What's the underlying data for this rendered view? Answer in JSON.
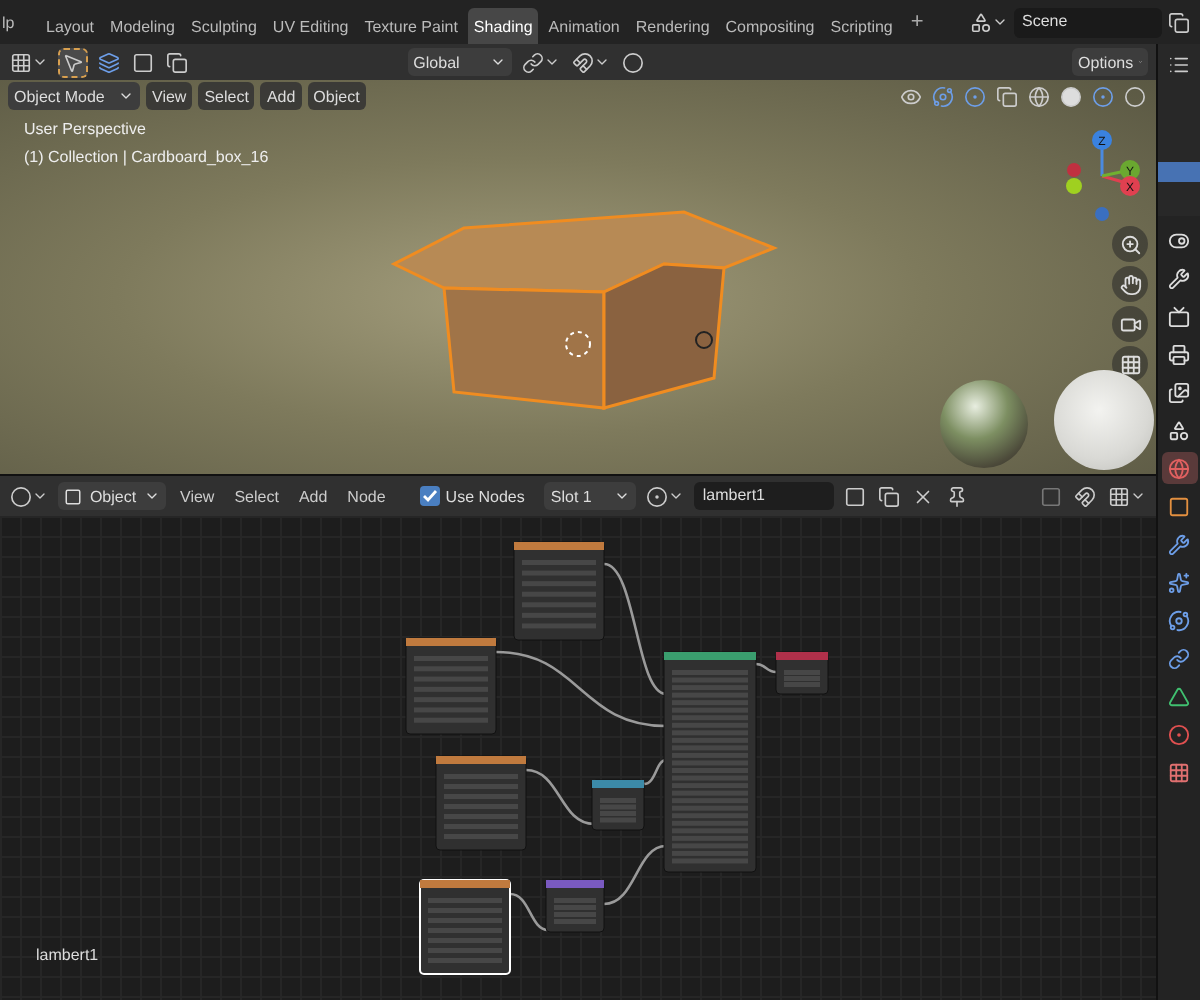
{
  "menu_fragment": "lp",
  "workspace_tabs": [
    {
      "label": "Layout",
      "selected": false
    },
    {
      "label": "Modeling",
      "selected": false
    },
    {
      "label": "Sculpting",
      "selected": false
    },
    {
      "label": "UV Editing",
      "selected": false
    },
    {
      "label": "Texture Paint",
      "selected": false
    },
    {
      "label": "Shading",
      "selected": true
    },
    {
      "label": "Animation",
      "selected": false
    },
    {
      "label": "Rendering",
      "selected": false
    },
    {
      "label": "Compositing",
      "selected": false
    },
    {
      "label": "Scripting",
      "selected": false
    }
  ],
  "add_workspace": "+",
  "scene": {
    "value": "Scene"
  },
  "viewport": {
    "transform_orientation": "Global",
    "options": "Options",
    "mode": "Object Mode",
    "menus": [
      "View",
      "Select",
      "Add",
      "Object"
    ],
    "overlay_text": [
      "User Perspective",
      "(1) Collection | Cardboard_box_16"
    ],
    "gizmo_axes": [
      "Z",
      "Y",
      "X"
    ]
  },
  "node_editor": {
    "type": "Object",
    "menus": [
      "View",
      "Select",
      "Add",
      "Node"
    ],
    "use_nodes": {
      "label": "Use Nodes",
      "checked": true
    },
    "slot": "Slot 1",
    "material": "lambert1",
    "material_label": "lambert1"
  },
  "property_tabs": [
    {
      "kind": "toggle",
      "selected": false
    },
    {
      "kind": "tool",
      "selected": false
    },
    {
      "kind": "render",
      "selected": false
    },
    {
      "kind": "output",
      "selected": false
    },
    {
      "kind": "view_layer",
      "selected": false
    },
    {
      "kind": "scene",
      "selected": false
    },
    {
      "kind": "world",
      "selected": true
    },
    {
      "kind": "object",
      "selected": false
    },
    {
      "kind": "modifiers",
      "selected": false
    },
    {
      "kind": "particles",
      "selected": false
    },
    {
      "kind": "physics",
      "selected": false
    },
    {
      "kind": "constraints",
      "selected": false
    },
    {
      "kind": "data",
      "selected": false
    },
    {
      "kind": "material",
      "selected": false
    },
    {
      "kind": "texture",
      "selected": false
    }
  ]
}
